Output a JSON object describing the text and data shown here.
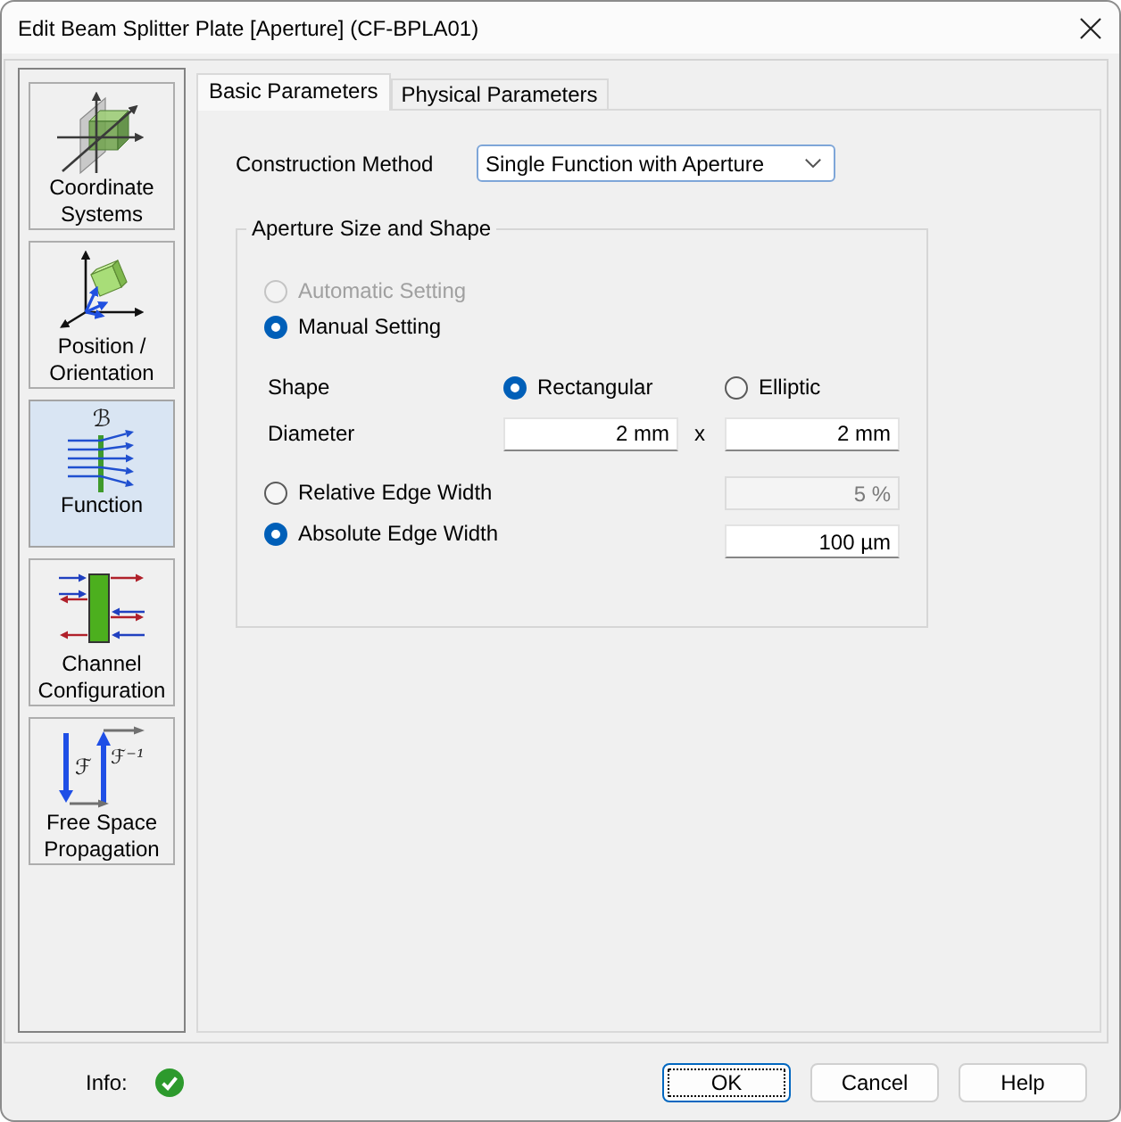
{
  "window": {
    "title": "Edit Beam Splitter Plate [Aperture] (CF-BPLA01)"
  },
  "sidebar": {
    "items": [
      {
        "kind": "coordinates",
        "label": "Coordinate Systems",
        "selected": false
      },
      {
        "kind": "orientation",
        "label": "Position / Orientation",
        "selected": false
      },
      {
        "kind": "function",
        "label": "Function",
        "symbols": [
          "ℬ"
        ],
        "selected": true
      },
      {
        "kind": "channels",
        "label": "Channel Configuration",
        "selected": false
      },
      {
        "kind": "propagation",
        "label": "Free Space Propagation",
        "symbols": [
          "ℱ",
          "ℱ⁻¹"
        ],
        "selected": false
      }
    ]
  },
  "tabs": [
    {
      "label": "Basic Parameters",
      "selected": true
    },
    {
      "label": "Physical Parameters",
      "selected": false
    }
  ],
  "construction_method": {
    "label": "Construction Method",
    "value": "Single Function with Aperture"
  },
  "aperture_group": {
    "title": "Aperture Size and Shape",
    "setting_options": [
      {
        "label": "Automatic Setting",
        "selected": false,
        "disabled": true
      },
      {
        "label": "Manual Setting",
        "selected": true,
        "disabled": false
      }
    ],
    "shape": {
      "label": "Shape",
      "options": [
        {
          "label": "Rectangular",
          "selected": true
        },
        {
          "label": "Elliptic",
          "selected": false
        }
      ]
    },
    "diameter": {
      "label": "Diameter",
      "x_value": "2 mm",
      "separator": "x",
      "y_value": "2 mm"
    },
    "edge_width_options": [
      {
        "label": "Relative Edge Width",
        "selected": false,
        "value": "5 %"
      },
      {
        "label": "Absolute Edge Width",
        "selected": true,
        "value": "100 µm"
      }
    ]
  },
  "footer": {
    "info": {
      "label": "Info:",
      "ok": true
    },
    "buttons": [
      {
        "label": "OK",
        "focused": true
      },
      {
        "label": "Cancel",
        "focused": false
      },
      {
        "label": "Help",
        "focused": false
      }
    ]
  }
}
